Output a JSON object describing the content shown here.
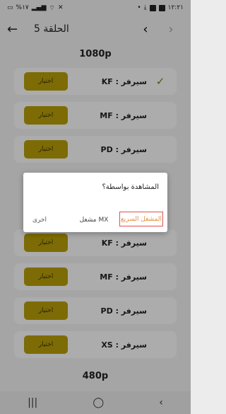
{
  "status_bar": {
    "time": "١٢:٢١",
    "battery": "%١٧"
  },
  "app_bar": {
    "title": "الحلقة 5",
    "icons": [
      "back-arrow-icon",
      "chevron-left-icon",
      "chevron-right-icon"
    ]
  },
  "sections": [
    {
      "title": "1080p"
    },
    {
      "title": "480p"
    }
  ],
  "servers": [
    {
      "label": "سيرفر : KF",
      "button": "اختيار",
      "selected": true
    },
    {
      "label": "سيرفر : MF",
      "button": "اختيار",
      "selected": false
    },
    {
      "label": "سيرفر : PD",
      "button": "اختيار",
      "selected": false
    },
    {
      "label": "سيرفر : KF",
      "button": "اختيار",
      "selected": false
    },
    {
      "label": "سيرفر : MF",
      "button": "اختيار",
      "selected": false
    },
    {
      "label": "سيرفر : PD",
      "button": "اختيار",
      "selected": false
    },
    {
      "label": "سيرفر : XS",
      "button": "اختيار",
      "selected": false
    }
  ],
  "dialog": {
    "title": "المشاهدة بواسطة؟",
    "fast_player": "المشغل السريع",
    "mx_player": "مشغل MX",
    "other": "اخرى"
  },
  "colors": {
    "accent": "#b39a08",
    "check": "#6e7e1a",
    "highlight_border": "#e05050"
  }
}
